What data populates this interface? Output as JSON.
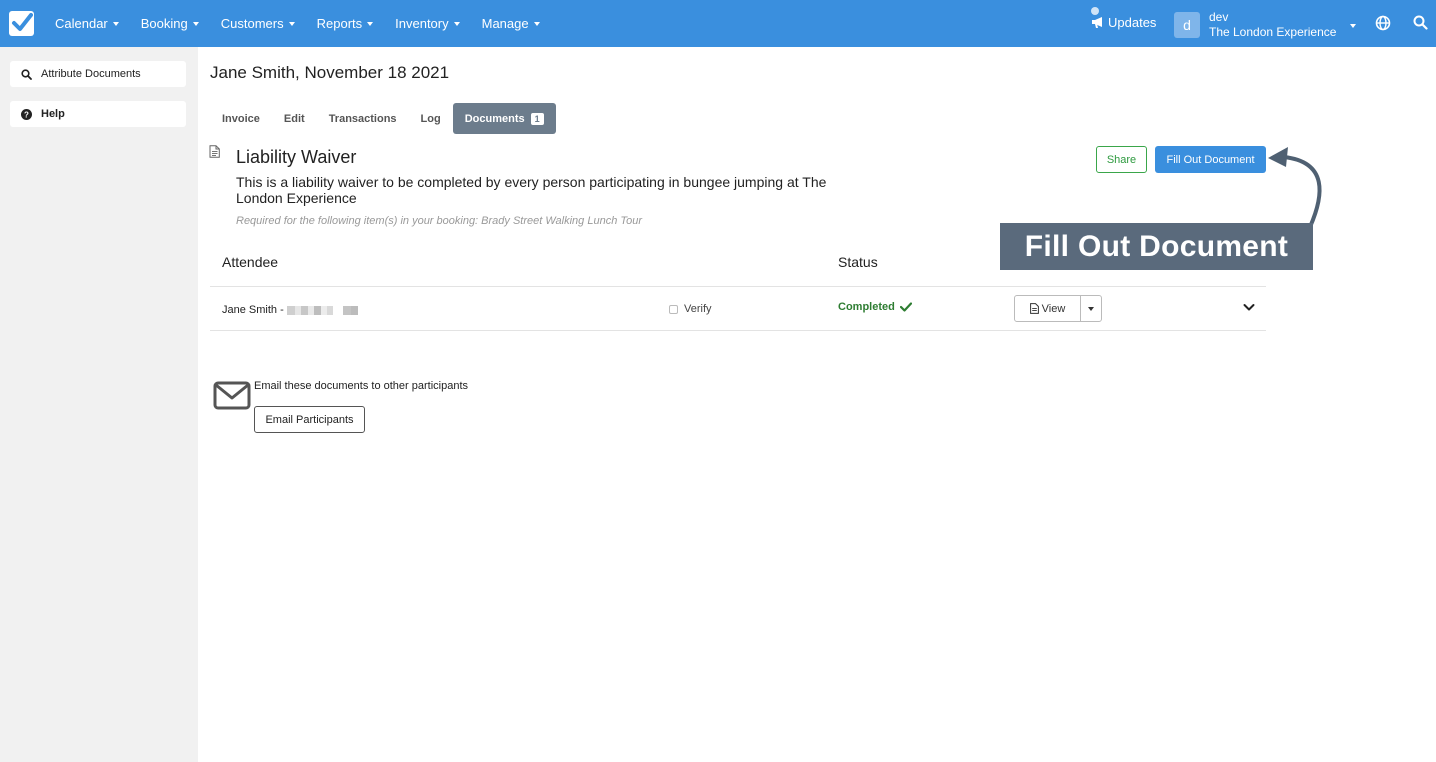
{
  "nav": {
    "items": [
      {
        "label": "Calendar"
      },
      {
        "label": "Booking"
      },
      {
        "label": "Customers"
      },
      {
        "label": "Reports"
      },
      {
        "label": "Inventory"
      },
      {
        "label": "Manage"
      }
    ],
    "updates_label": "Updates",
    "user": {
      "initial": "d",
      "name": "dev",
      "company": "The London Experience"
    }
  },
  "sidebar": {
    "items": [
      {
        "label": "Attribute Documents",
        "icon": "search-icon"
      },
      {
        "label": "Help",
        "icon": "question-circle-icon"
      }
    ]
  },
  "page": {
    "title": "Jane Smith, November 18 2021",
    "tabs": [
      {
        "label": "Invoice"
      },
      {
        "label": "Edit"
      },
      {
        "label": "Transactions"
      },
      {
        "label": "Log"
      },
      {
        "label": "Documents",
        "badge": "1",
        "active": true
      }
    ]
  },
  "document": {
    "title": "Liability Waiver",
    "description": "This is a liability waiver to be completed by every person participating in bungee jumping at The London Experience",
    "required_note": "Required for the following item(s) in your booking: Brady Street Walking Lunch Tour",
    "share_label": "Share",
    "fill_label": "Fill Out Document"
  },
  "callout": {
    "text": "Fill Out Document"
  },
  "table": {
    "headers": {
      "attendee": "Attendee",
      "status": "Status"
    },
    "rows": [
      {
        "name": "Jane Smith -",
        "verify_label": "Verify",
        "status": "Completed",
        "view_label": "View"
      }
    ]
  },
  "email": {
    "text": "Email these documents to other participants",
    "button_label": "Email Participants"
  },
  "colors": {
    "brand": "#3a8fde",
    "success": "#2e7d32",
    "callout": "#5a6a7c"
  }
}
